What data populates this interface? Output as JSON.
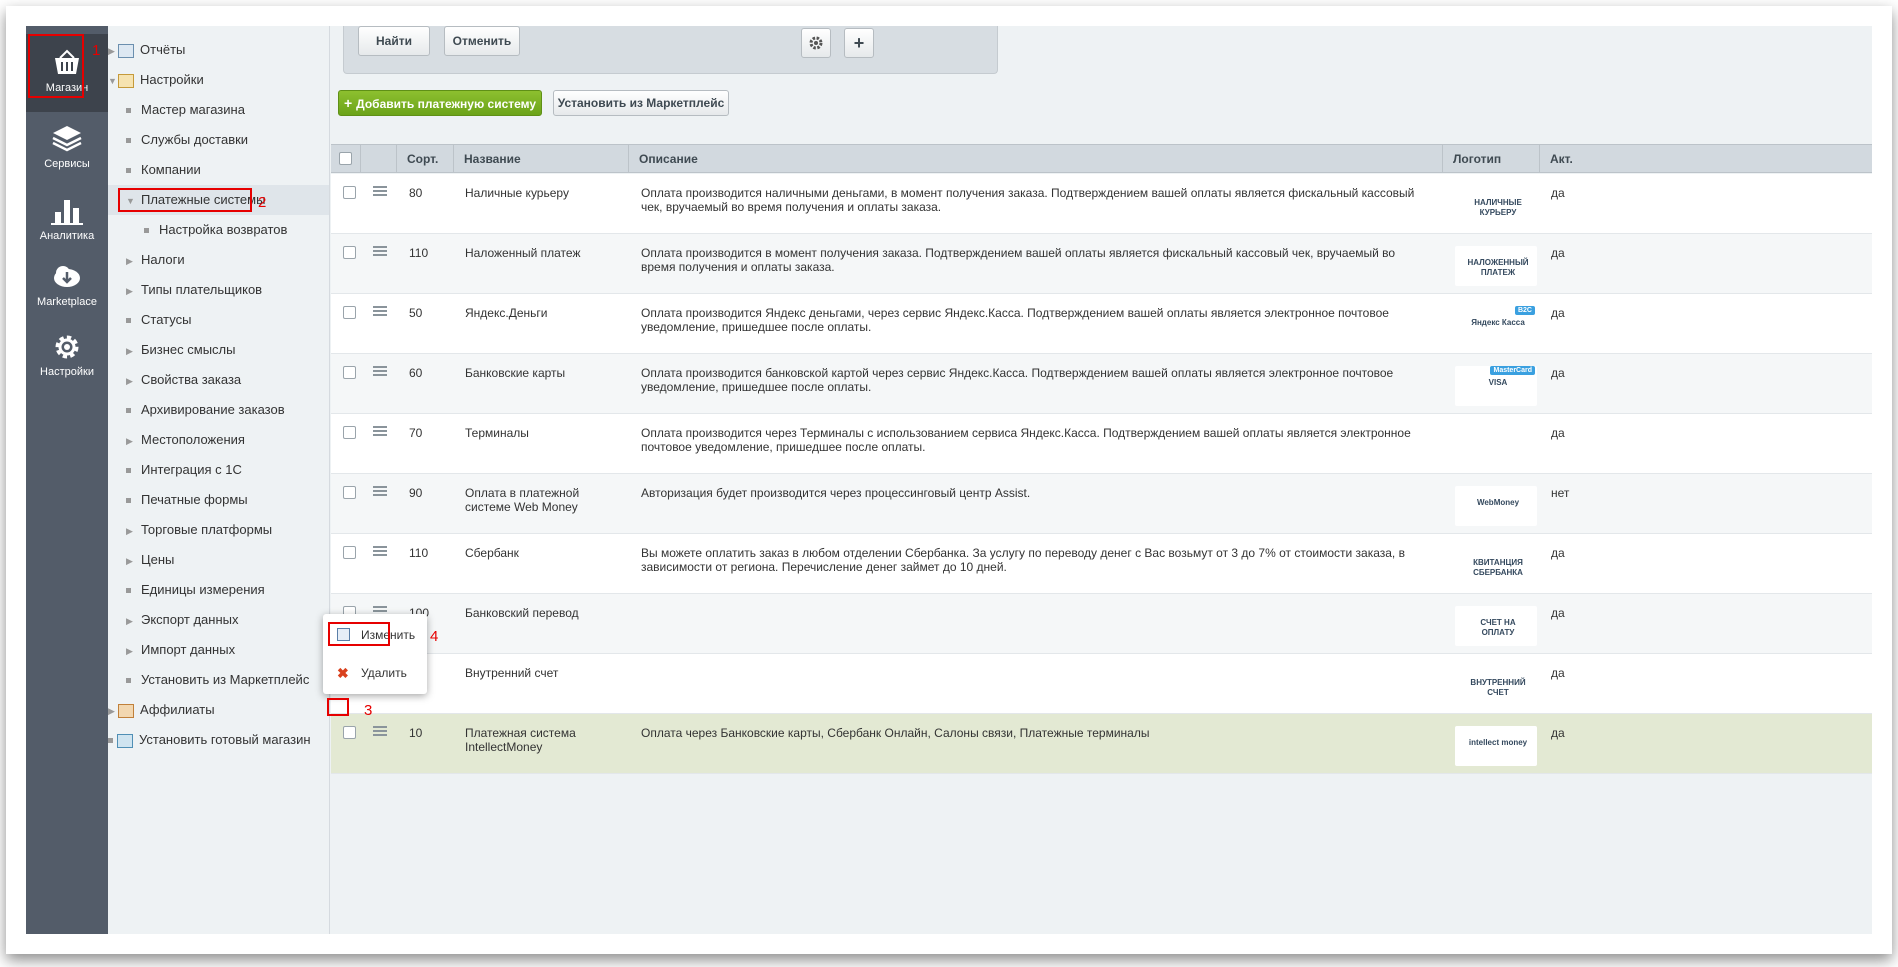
{
  "sidebar_main": {
    "items": [
      {
        "label": "Магазин",
        "icon": "basket-icon"
      },
      {
        "label": "Сервисы",
        "icon": "layers-icon"
      },
      {
        "label": "Аналитика",
        "icon": "bar-chart-icon"
      },
      {
        "label": "Marketplace",
        "icon": "cloud-download-icon"
      },
      {
        "label": "Настройки",
        "icon": "gear-icon"
      }
    ]
  },
  "tree": {
    "items": [
      {
        "label": "Отчёты"
      },
      {
        "label": "Настройки"
      },
      {
        "label": "Мастер магазина"
      },
      {
        "label": "Службы доставки"
      },
      {
        "label": "Компании"
      },
      {
        "label": "Платежные системы"
      },
      {
        "label": "Настройка возвратов"
      },
      {
        "label": "Налоги"
      },
      {
        "label": "Типы плательщиков"
      },
      {
        "label": "Статусы"
      },
      {
        "label": "Бизнес смыслы"
      },
      {
        "label": "Свойства заказа"
      },
      {
        "label": "Архивирование заказов"
      },
      {
        "label": "Местоположения"
      },
      {
        "label": "Интеграция с 1С"
      },
      {
        "label": "Печатные формы"
      },
      {
        "label": "Торговые платформы"
      },
      {
        "label": "Цены"
      },
      {
        "label": "Единицы измерения"
      },
      {
        "label": "Экспорт данных"
      },
      {
        "label": "Импорт данных"
      },
      {
        "label": "Установить из Маркетплейс"
      },
      {
        "label": "Аффилиаты"
      },
      {
        "label": "Установить готовый магазин"
      }
    ]
  },
  "filter": {
    "find_label": "Найти",
    "cancel_label": "Отменить",
    "settings_icon": "gear-icon",
    "add_icon": "plus-icon"
  },
  "toolbar": {
    "add_label": "Добавить платежную систему",
    "install_label": "Установить из Маркетплейс"
  },
  "grid": {
    "columns": {
      "sort": "Сорт.",
      "name": "Название",
      "description": "Описание",
      "logo": "Логотип",
      "active": "Акт."
    },
    "rows": [
      {
        "sort": "80",
        "name": "Наличные курьеру",
        "description": "Оплата производится наличными деньгами, в момент получения заказа. Подтверждением вашей оплаты является фискальный кассовый чек, вручаемый во время получения и оплаты заказа.",
        "logo_text": "НАЛИЧНЫЕ КУРЬЕРУ",
        "active": "да"
      },
      {
        "sort": "110",
        "name": "Наложенный платеж",
        "description": "Оплата производится в момент получения заказа. Подтверждением вашей оплаты является фискальный кассовый чек, вручаемый во время получения и оплаты заказа.",
        "logo_text": "НАЛОЖЕННЫЙ ПЛАТЕЖ",
        "active": "да"
      },
      {
        "sort": "50",
        "name": "Яндекс.Деньги",
        "description": "Оплата производится Яндекс деньгами, через сервис Яндекс.Касса. Подтверждением вашей оплаты является электронное почтовое уведомление, пришедшее после оплаты.",
        "logo_text": "Яндекс Касса",
        "logo_badge": "B2C",
        "active": "да"
      },
      {
        "sort": "60",
        "name": "Банковские карты",
        "description": "Оплата производится банковской картой через сервис Яндекс.Касса. Подтверждением вашей оплаты является электронное почтовое уведомление, пришедшее после оплаты.",
        "logo_text": "VISA",
        "logo_badge": "MasterCard",
        "active": "да"
      },
      {
        "sort": "70",
        "name": "Терминалы",
        "description": "Оплата производится через Терминалы с использованием сервиса Яндекс.Касса. Подтверждением вашей оплаты является электронное почтовое уведомление, пришедшее после оплаты.",
        "logo_text": "",
        "active": "да"
      },
      {
        "sort": "90",
        "name": "Оплата в платежной системе Web Money",
        "description": "Авторизация будет производится через процессинговый центр Assist.",
        "logo_text": "WebMoney",
        "active": "нет"
      },
      {
        "sort": "110",
        "name": "Сбербанк",
        "description": "Вы можете оплатить заказ в любом отделении Сбербанка. За услугу по переводу денег с Вас возьмут от 3 до 7% от стоимости заказа, в зависимости от региона. Перечисление денег займет до 10 дней.",
        "logo_text": "КВИТАНЦИЯ СБЕРБАНКА",
        "active": "да"
      },
      {
        "sort": "100",
        "name": "Банковский перевод",
        "description": "",
        "logo_text": "СЧЕТ НА ОПЛАТУ",
        "active": "да"
      },
      {
        "sort": "",
        "name": "Внутренний счет",
        "description": "",
        "logo_text": "ВНУТРЕННИЙ СЧЕТ",
        "active": "да"
      },
      {
        "sort": "10",
        "name": "Платежная система IntellectMoney",
        "description": "Оплата через Банковские карты, Сбербанк Онлайн, Салоны связи, Платежные терминалы",
        "logo_text": "intellect money",
        "active": "да"
      }
    ]
  },
  "context_menu": {
    "edit_label": "Изменить",
    "delete_label": "Удалить"
  },
  "annotations": [
    "1",
    "2",
    "3",
    "4"
  ],
  "colors": {
    "accent_green": "#6ba319",
    "annotation_red": "#e60000",
    "sidebar_dark": "#535c69"
  }
}
